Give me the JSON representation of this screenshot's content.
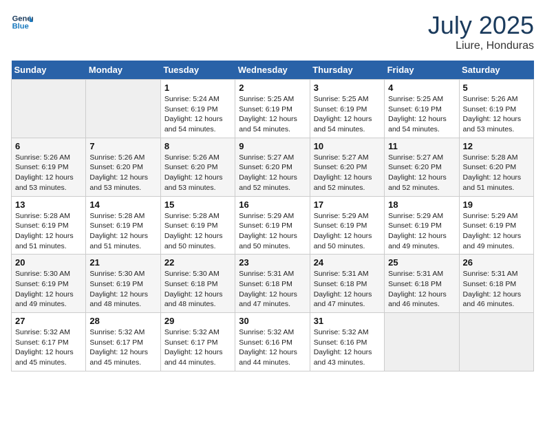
{
  "header": {
    "logo_line1": "General",
    "logo_line2": "Blue",
    "month_title": "July 2025",
    "location": "Liure, Honduras"
  },
  "weekdays": [
    "Sunday",
    "Monday",
    "Tuesday",
    "Wednesday",
    "Thursday",
    "Friday",
    "Saturday"
  ],
  "weeks": [
    [
      {
        "day": "",
        "empty": true
      },
      {
        "day": "",
        "empty": true
      },
      {
        "day": "1",
        "sunrise": "Sunrise: 5:24 AM",
        "sunset": "Sunset: 6:19 PM",
        "daylight": "Daylight: 12 hours and 54 minutes."
      },
      {
        "day": "2",
        "sunrise": "Sunrise: 5:25 AM",
        "sunset": "Sunset: 6:19 PM",
        "daylight": "Daylight: 12 hours and 54 minutes."
      },
      {
        "day": "3",
        "sunrise": "Sunrise: 5:25 AM",
        "sunset": "Sunset: 6:19 PM",
        "daylight": "Daylight: 12 hours and 54 minutes."
      },
      {
        "day": "4",
        "sunrise": "Sunrise: 5:25 AM",
        "sunset": "Sunset: 6:19 PM",
        "daylight": "Daylight: 12 hours and 54 minutes."
      },
      {
        "day": "5",
        "sunrise": "Sunrise: 5:26 AM",
        "sunset": "Sunset: 6:19 PM",
        "daylight": "Daylight: 12 hours and 53 minutes."
      }
    ],
    [
      {
        "day": "6",
        "sunrise": "Sunrise: 5:26 AM",
        "sunset": "Sunset: 6:19 PM",
        "daylight": "Daylight: 12 hours and 53 minutes."
      },
      {
        "day": "7",
        "sunrise": "Sunrise: 5:26 AM",
        "sunset": "Sunset: 6:20 PM",
        "daylight": "Daylight: 12 hours and 53 minutes."
      },
      {
        "day": "8",
        "sunrise": "Sunrise: 5:26 AM",
        "sunset": "Sunset: 6:20 PM",
        "daylight": "Daylight: 12 hours and 53 minutes."
      },
      {
        "day": "9",
        "sunrise": "Sunrise: 5:27 AM",
        "sunset": "Sunset: 6:20 PM",
        "daylight": "Daylight: 12 hours and 52 minutes."
      },
      {
        "day": "10",
        "sunrise": "Sunrise: 5:27 AM",
        "sunset": "Sunset: 6:20 PM",
        "daylight": "Daylight: 12 hours and 52 minutes."
      },
      {
        "day": "11",
        "sunrise": "Sunrise: 5:27 AM",
        "sunset": "Sunset: 6:20 PM",
        "daylight": "Daylight: 12 hours and 52 minutes."
      },
      {
        "day": "12",
        "sunrise": "Sunrise: 5:28 AM",
        "sunset": "Sunset: 6:20 PM",
        "daylight": "Daylight: 12 hours and 51 minutes."
      }
    ],
    [
      {
        "day": "13",
        "sunrise": "Sunrise: 5:28 AM",
        "sunset": "Sunset: 6:19 PM",
        "daylight": "Daylight: 12 hours and 51 minutes."
      },
      {
        "day": "14",
        "sunrise": "Sunrise: 5:28 AM",
        "sunset": "Sunset: 6:19 PM",
        "daylight": "Daylight: 12 hours and 51 minutes."
      },
      {
        "day": "15",
        "sunrise": "Sunrise: 5:28 AM",
        "sunset": "Sunset: 6:19 PM",
        "daylight": "Daylight: 12 hours and 50 minutes."
      },
      {
        "day": "16",
        "sunrise": "Sunrise: 5:29 AM",
        "sunset": "Sunset: 6:19 PM",
        "daylight": "Daylight: 12 hours and 50 minutes."
      },
      {
        "day": "17",
        "sunrise": "Sunrise: 5:29 AM",
        "sunset": "Sunset: 6:19 PM",
        "daylight": "Daylight: 12 hours and 50 minutes."
      },
      {
        "day": "18",
        "sunrise": "Sunrise: 5:29 AM",
        "sunset": "Sunset: 6:19 PM",
        "daylight": "Daylight: 12 hours and 49 minutes."
      },
      {
        "day": "19",
        "sunrise": "Sunrise: 5:29 AM",
        "sunset": "Sunset: 6:19 PM",
        "daylight": "Daylight: 12 hours and 49 minutes."
      }
    ],
    [
      {
        "day": "20",
        "sunrise": "Sunrise: 5:30 AM",
        "sunset": "Sunset: 6:19 PM",
        "daylight": "Daylight: 12 hours and 49 minutes."
      },
      {
        "day": "21",
        "sunrise": "Sunrise: 5:30 AM",
        "sunset": "Sunset: 6:19 PM",
        "daylight": "Daylight: 12 hours and 48 minutes."
      },
      {
        "day": "22",
        "sunrise": "Sunrise: 5:30 AM",
        "sunset": "Sunset: 6:18 PM",
        "daylight": "Daylight: 12 hours and 48 minutes."
      },
      {
        "day": "23",
        "sunrise": "Sunrise: 5:31 AM",
        "sunset": "Sunset: 6:18 PM",
        "daylight": "Daylight: 12 hours and 47 minutes."
      },
      {
        "day": "24",
        "sunrise": "Sunrise: 5:31 AM",
        "sunset": "Sunset: 6:18 PM",
        "daylight": "Daylight: 12 hours and 47 minutes."
      },
      {
        "day": "25",
        "sunrise": "Sunrise: 5:31 AM",
        "sunset": "Sunset: 6:18 PM",
        "daylight": "Daylight: 12 hours and 46 minutes."
      },
      {
        "day": "26",
        "sunrise": "Sunrise: 5:31 AM",
        "sunset": "Sunset: 6:18 PM",
        "daylight": "Daylight: 12 hours and 46 minutes."
      }
    ],
    [
      {
        "day": "27",
        "sunrise": "Sunrise: 5:32 AM",
        "sunset": "Sunset: 6:17 PM",
        "daylight": "Daylight: 12 hours and 45 minutes."
      },
      {
        "day": "28",
        "sunrise": "Sunrise: 5:32 AM",
        "sunset": "Sunset: 6:17 PM",
        "daylight": "Daylight: 12 hours and 45 minutes."
      },
      {
        "day": "29",
        "sunrise": "Sunrise: 5:32 AM",
        "sunset": "Sunset: 6:17 PM",
        "daylight": "Daylight: 12 hours and 44 minutes."
      },
      {
        "day": "30",
        "sunrise": "Sunrise: 5:32 AM",
        "sunset": "Sunset: 6:16 PM",
        "daylight": "Daylight: 12 hours and 44 minutes."
      },
      {
        "day": "31",
        "sunrise": "Sunrise: 5:32 AM",
        "sunset": "Sunset: 6:16 PM",
        "daylight": "Daylight: 12 hours and 43 minutes."
      },
      {
        "day": "",
        "empty": true
      },
      {
        "day": "",
        "empty": true
      }
    ]
  ]
}
